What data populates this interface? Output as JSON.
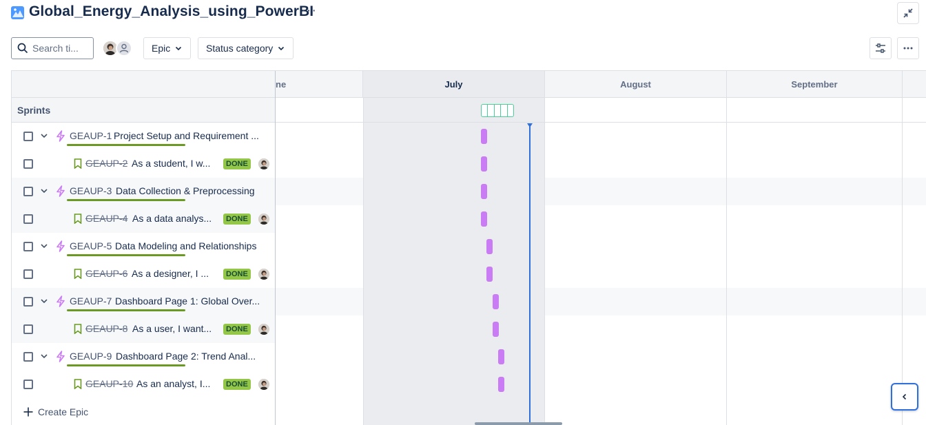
{
  "project": {
    "title": "Global_Energy_Analysis_using_PowerBI",
    "more_label": "···"
  },
  "toolbar": {
    "search_placeholder": "Search ti...",
    "epic_filter_label": "Epic",
    "status_filter_label": "Status category"
  },
  "timeline": {
    "months": [
      "ne",
      "July",
      "August",
      "September"
    ],
    "sprints_label": "Sprints",
    "create_label": "Create Epic"
  },
  "rows": [
    {
      "type": "epic",
      "key": "GEAUP-1",
      "summary": "Project Setup and Requirement ...",
      "bar_start": "Jul 10",
      "bar_end": "Jul 12"
    },
    {
      "type": "story",
      "key": "GEAUP-2",
      "summary": "As a student, I w...",
      "status": "DONE",
      "bar_start": "Jul 10",
      "bar_end": "Jul 12"
    },
    {
      "type": "epic",
      "key": "GEAUP-3",
      "summary": "Data Collection & Preprocessing",
      "bar_start": "Jul 10",
      "bar_end": "Jul 12"
    },
    {
      "type": "story",
      "key": "GEAUP-4",
      "summary": "As a data analys...",
      "status": "DONE",
      "bar_start": "Jul 10",
      "bar_end": "Jul 12"
    },
    {
      "type": "epic",
      "key": "GEAUP-5",
      "summary": "Data Modeling and Relationships",
      "bar_start": "Jul 12",
      "bar_end": "Jul 14"
    },
    {
      "type": "story",
      "key": "GEAUP-6",
      "summary": "As a designer, I ...",
      "status": "DONE",
      "bar_start": "Jul 12",
      "bar_end": "Jul 14"
    },
    {
      "type": "epic",
      "key": "GEAUP-7",
      "summary": "Dashboard Page 1: Global Over...",
      "bar_start": "Jul 14",
      "bar_end": "Jul 16"
    },
    {
      "type": "story",
      "key": "GEAUP-8",
      "summary": "As a user, I want...",
      "status": "DONE",
      "bar_start": "Jul 14",
      "bar_end": "Jul 16"
    },
    {
      "type": "epic",
      "key": "GEAUP-9",
      "summary": "Dashboard Page 2: Trend Anal...",
      "bar_start": "Jul 16",
      "bar_end": "Jul 18"
    },
    {
      "type": "story",
      "key": "GEAUP-10",
      "summary": "As an analyst, I...",
      "status": "DONE",
      "bar_start": "Jul 16",
      "bar_end": "Jul 18"
    }
  ],
  "colors": {
    "epic": "#c97cf4",
    "done_badge": "#94c748",
    "today_marker": "#2f6fdb",
    "sprint": "#4bce97",
    "epic_progress": "#6a9a23"
  },
  "icons": [
    "search-icon",
    "chevron-down-icon",
    "epic-lightning-icon",
    "story-bookmark-icon",
    "plus-icon",
    "collapse-icon",
    "view-settings-icon",
    "more-icon",
    "chevron-left-icon"
  ]
}
